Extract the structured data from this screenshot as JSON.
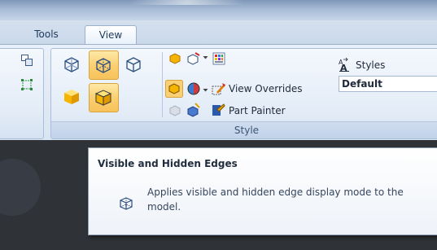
{
  "tabs": [
    {
      "label": "Tools",
      "selected": false
    },
    {
      "label": "View",
      "selected": true
    }
  ],
  "ribbon": {
    "view_overrides_label": "View Overrides",
    "view_overrides_value": "Default",
    "styles_label": "Styles",
    "part_painter_label": "Part Painter",
    "group_label": "Style"
  },
  "tooltip": {
    "title": "Visible and Hidden Edges",
    "description": "Applies visible and hidden edge display mode to the model."
  },
  "colors": {
    "active_button": "#fbd072",
    "ribbon_bg": "#e3ecf7",
    "document_bg": "#2f3236"
  }
}
